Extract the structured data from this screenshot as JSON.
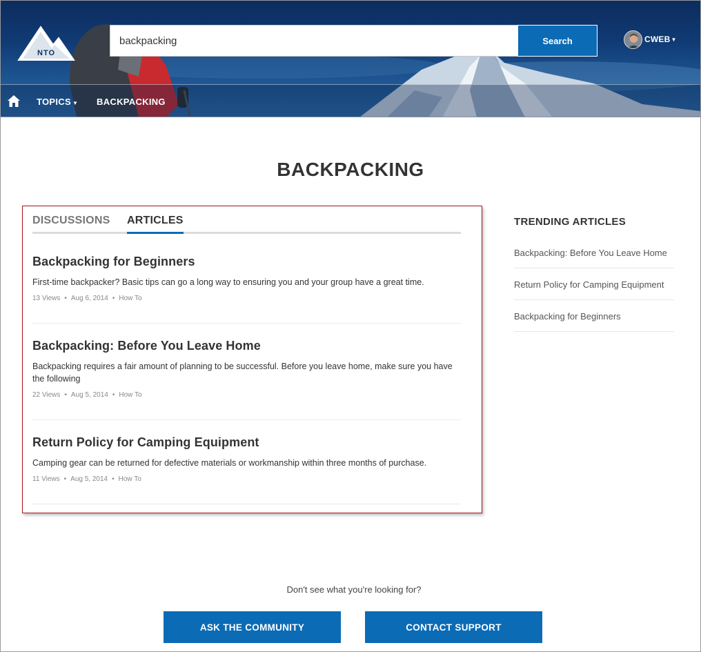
{
  "header": {
    "logo_text": "NTO",
    "search": {
      "value": "backpacking",
      "button_label": "Search"
    },
    "user": {
      "name": "CWEB"
    }
  },
  "nav": {
    "topics_label": "TOPICS",
    "current_label": "BACKPACKING"
  },
  "page": {
    "title": "BACKPACKING"
  },
  "feed": {
    "tabs": [
      {
        "label": "DISCUSSIONS",
        "active": false
      },
      {
        "label": "ARTICLES",
        "active": true
      }
    ],
    "articles": [
      {
        "title": "Backpacking for Beginners",
        "summary": "First-time backpacker? Basic tips can go a long way to ensuring you and your group have a great time.",
        "views": "13 Views",
        "date": "Aug 6, 2014",
        "type": "How To"
      },
      {
        "title": "Backpacking: Before You Leave Home",
        "summary": "Backpacking requires a fair amount of planning to be successful. Before you leave home, make sure you have the following",
        "views": "22 Views",
        "date": "Aug 5, 2014",
        "type": "How To"
      },
      {
        "title": "Return Policy for Camping Equipment",
        "summary": "Camping gear can be returned for defective materials or workmanship within three months of purchase.",
        "views": "11 Views",
        "date": "Aug 5, 2014",
        "type": "How To"
      }
    ]
  },
  "trending": {
    "title": "TRENDING ARTICLES",
    "items": [
      "Backpacking: Before You Leave Home",
      "Return Policy for Camping Equipment",
      "Backpacking for Beginners"
    ]
  },
  "footer": {
    "prompt": "Don't see what you're looking for?",
    "ask_label": "ASK THE COMMUNITY",
    "contact_label": "CONTACT SUPPORT"
  },
  "colors": {
    "brand_blue": "#0b6bb5",
    "highlight_border": "#a3161b"
  }
}
